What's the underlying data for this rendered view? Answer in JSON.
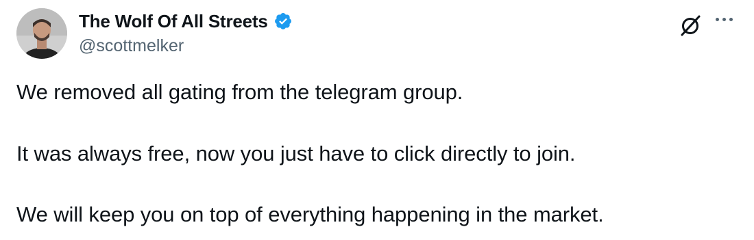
{
  "author": {
    "display_name": "The Wolf Of All Streets",
    "handle": "@scottmelker",
    "verified": true,
    "avatar": "profile-photo"
  },
  "icons": {
    "verified": "verified-badge-icon",
    "x_logo": "grok-slash-icon",
    "more": "more-options-icon"
  },
  "tweet": {
    "lines": [
      "We removed all gating from the telegram group.",
      "It was always free, now you just have to click directly to join.",
      "We will keep you on top of everything happening in the market."
    ]
  },
  "colors": {
    "verified_blue": "#1d9bf0",
    "text": "#0f1419",
    "secondary_text": "#536471"
  }
}
